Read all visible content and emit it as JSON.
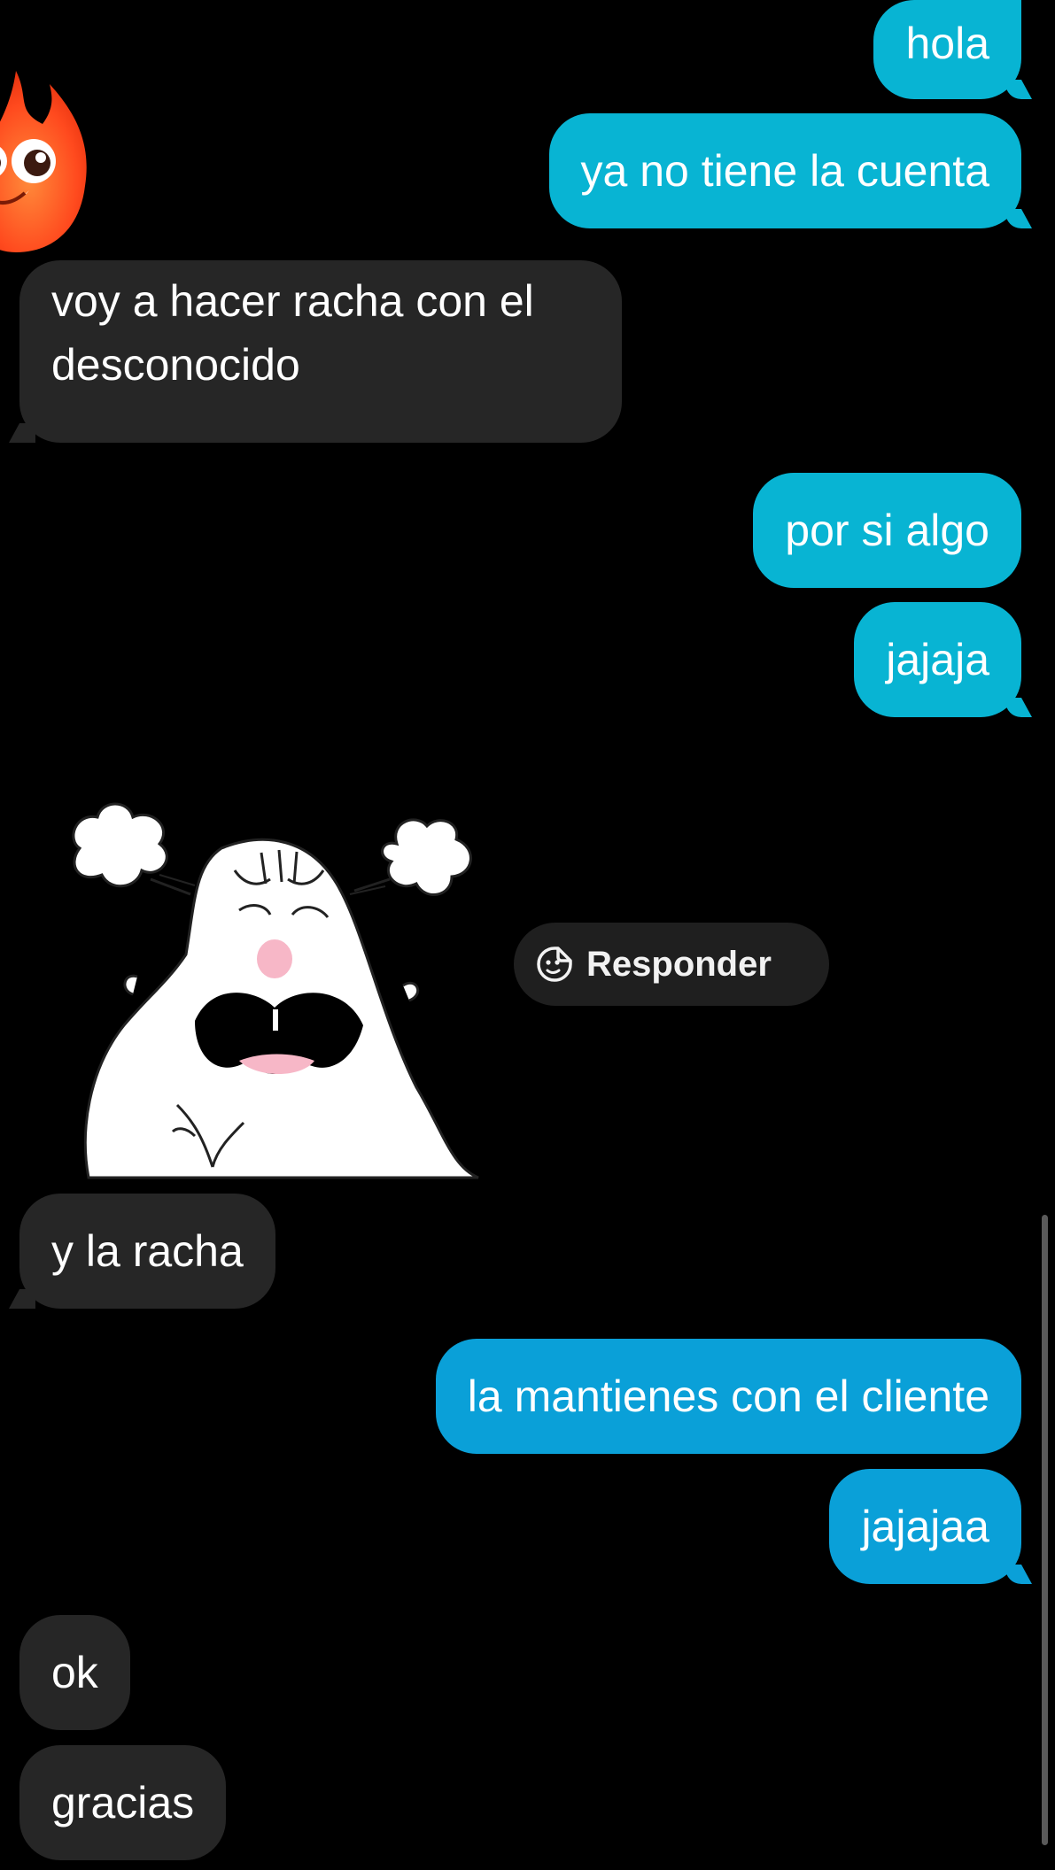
{
  "colors": {
    "background": "#000000",
    "outgoing_bubble": "#08b4d3",
    "outgoing_bubble_late": "#0aa0d8",
    "incoming_bubble": "#262626",
    "reply_pill": "#1f1f1f",
    "text": "#ffffff"
  },
  "messages": [
    {
      "direction": "out",
      "text": "hola"
    },
    {
      "direction": "out",
      "text": "ya no tiene la cuenta"
    },
    {
      "direction": "in",
      "text": "voy a hacer racha con el desconocido"
    },
    {
      "direction": "out",
      "text": "por si algo"
    },
    {
      "direction": "out",
      "text": "jajaja"
    },
    {
      "direction": "in",
      "type": "sticker",
      "sticker": "angry-white-blob-sticker"
    },
    {
      "direction": "in",
      "text": "y la racha"
    },
    {
      "direction": "out",
      "text": "la mantienes con el cliente"
    },
    {
      "direction": "out",
      "text": "jajajaa"
    },
    {
      "direction": "in",
      "text": "ok"
    },
    {
      "direction": "in",
      "text": "gracias"
    }
  ],
  "reply_button": {
    "label": "Responder",
    "icon": "sticker-face-icon"
  },
  "avatar": {
    "icon": "fire-streak-icon"
  }
}
